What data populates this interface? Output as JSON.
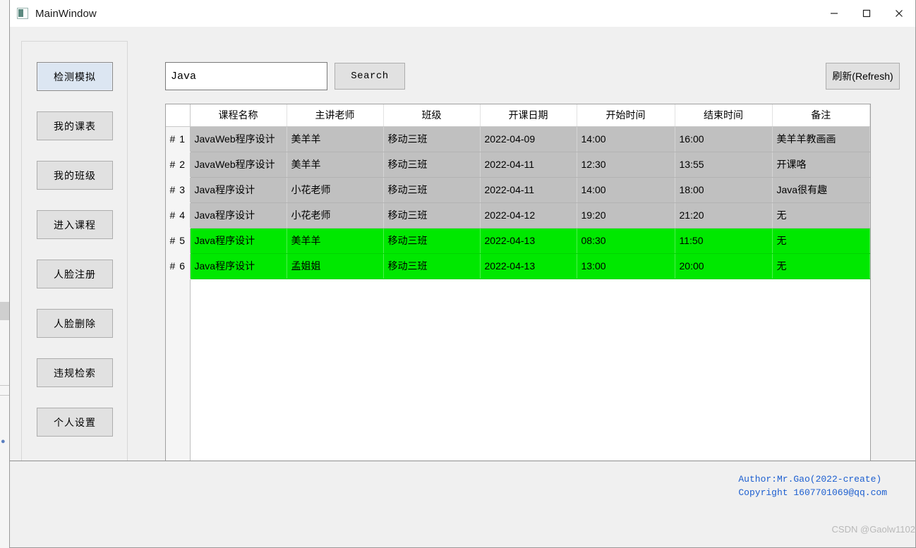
{
  "window": {
    "title": "MainWindow",
    "icon": "app-icon",
    "controls": {
      "minimize": "minimize-icon",
      "maximize": "maximize-icon",
      "close": "close-icon"
    }
  },
  "sidebar": {
    "items": [
      {
        "label": "检测模拟",
        "focused": true
      },
      {
        "label": "我的课表",
        "focused": false
      },
      {
        "label": "我的班级",
        "focused": false
      },
      {
        "label": "进入课程",
        "focused": false
      },
      {
        "label": "人脸注册",
        "focused": false
      },
      {
        "label": "人脸删除",
        "focused": false
      },
      {
        "label": "违规检索",
        "focused": false
      },
      {
        "label": "个人设置",
        "focused": false
      }
    ]
  },
  "toolbar": {
    "search_value": "Java",
    "search_placeholder": "",
    "search_label": "Search",
    "refresh_label": "刷新(Refresh)"
  },
  "table": {
    "gutter_header": "",
    "columns": [
      "课程名称",
      "主讲老师",
      "班级",
      "开课日期",
      "开始时间",
      "结束时间",
      "备注"
    ],
    "rows": [
      {
        "index": "# 1",
        "highlight": false,
        "cells": [
          "JavaWeb程序设计",
          "美羊羊",
          "移动三班",
          "2022-04-09",
          "14:00",
          "16:00",
          "美羊羊教画画"
        ]
      },
      {
        "index": "# 2",
        "highlight": false,
        "cells": [
          "JavaWeb程序设计",
          "美羊羊",
          "移动三班",
          "2022-04-11",
          "12:30",
          "13:55",
          "开课咯"
        ]
      },
      {
        "index": "# 3",
        "highlight": false,
        "cells": [
          "Java程序设计",
          "小花老师",
          "移动三班",
          "2022-04-11",
          "14:00",
          "18:00",
          "Java很有趣"
        ]
      },
      {
        "index": "# 4",
        "highlight": false,
        "cells": [
          "Java程序设计",
          "小花老师",
          "移动三班",
          "2022-04-12",
          "19:20",
          "21:20",
          "无"
        ]
      },
      {
        "index": "# 5",
        "highlight": true,
        "cells": [
          "Java程序设计",
          "美羊羊",
          "移动三班",
          "2022-04-13",
          "08:30",
          "11:50",
          "无"
        ]
      },
      {
        "index": "# 6",
        "highlight": true,
        "cells": [
          "Java程序设计",
          "孟姐姐",
          "移动三班",
          "2022-04-13",
          "13:00",
          "20:00",
          "无"
        ]
      }
    ]
  },
  "footer": {
    "author_line": "Author:Mr.Gao(2022-create)",
    "copyright_line": "Copyright 1607701069@qq.com",
    "watermark": "CSDN @Gaolw1102"
  },
  "colors": {
    "highlight_row": "#00e800",
    "normal_row": "#c0c0c0",
    "credit_text": "#1d5fd0",
    "focus_button": "#dce6f2"
  }
}
